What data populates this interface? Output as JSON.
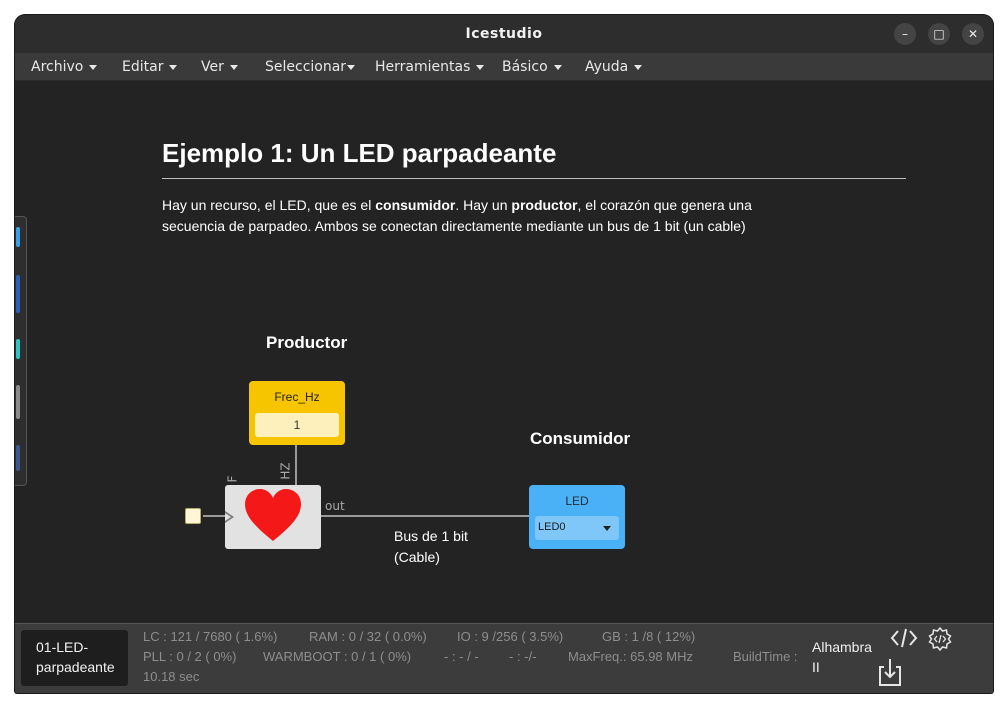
{
  "window": {
    "title": "Icestudio",
    "minimize": "–",
    "maximize": "□",
    "close": "✕"
  },
  "menu": [
    {
      "label": "Archivo"
    },
    {
      "label": "Editar"
    },
    {
      "label": "Ver"
    },
    {
      "label": "Seleccionar"
    },
    {
      "label": "Herramientas"
    },
    {
      "label": "Básico"
    },
    {
      "label": "Ayuda"
    }
  ],
  "canvas": {
    "heading": "Ejemplo 1: Un LED parpadeante",
    "paragraph": {
      "p1": "Hay un recurso, el LED, que es el ",
      "b1": "consumidor",
      "p2": ". Hay un ",
      "b2": "productor",
      "p3": ", el corazón que genera una secuencia de parpadeo. Ambos se conectan directamente mediante un bus de 1 bit (un cable)"
    },
    "producer_label": "Productor",
    "consumer_label": "Consumidor",
    "constant_block": {
      "name": "Frec_Hz",
      "value": "1"
    },
    "heart_block": {
      "pin_f": "F",
      "pin_hz": "HZ",
      "pin_out": "out"
    },
    "bus_label_line1": "Bus de 1 bit",
    "bus_label_line2": "(Cable)",
    "led_block": {
      "name": "LED",
      "selected_pin": "LED0"
    }
  },
  "status": {
    "project_line1": "01-LED-",
    "project_line2": "parpadeante",
    "lc": "LC : 121 / 7680 ( 1.6%)",
    "ram": "RAM : 0 / 32 ( 0.0%)",
    "io": "IO :  9 /256  ( 3.5%)",
    "gb": "GB :  1 /8  ( 12%)",
    "pll": "PLL : 0 / 2 ( 0%)",
    "warmboot": "WARMBOOT : 0 / 1 ( 0%)",
    "dash1": "- : - / -",
    "dash2": "- :  -/-",
    "maxfreq": "MaxFreq.:  65.98 MHz",
    "buildtime": "BuildTime :",
    "buildtime_value": "10.18 sec",
    "board_line1": "Alhambra",
    "board_line2": "II"
  },
  "colors": {
    "background": "#232323",
    "constant_block": "#f7c500",
    "led_block": "#4ab1f7",
    "heart": "#f51818"
  },
  "icons": [
    "code-icon",
    "code-settings-icon",
    "upload-icon",
    "heart-icon"
  ]
}
